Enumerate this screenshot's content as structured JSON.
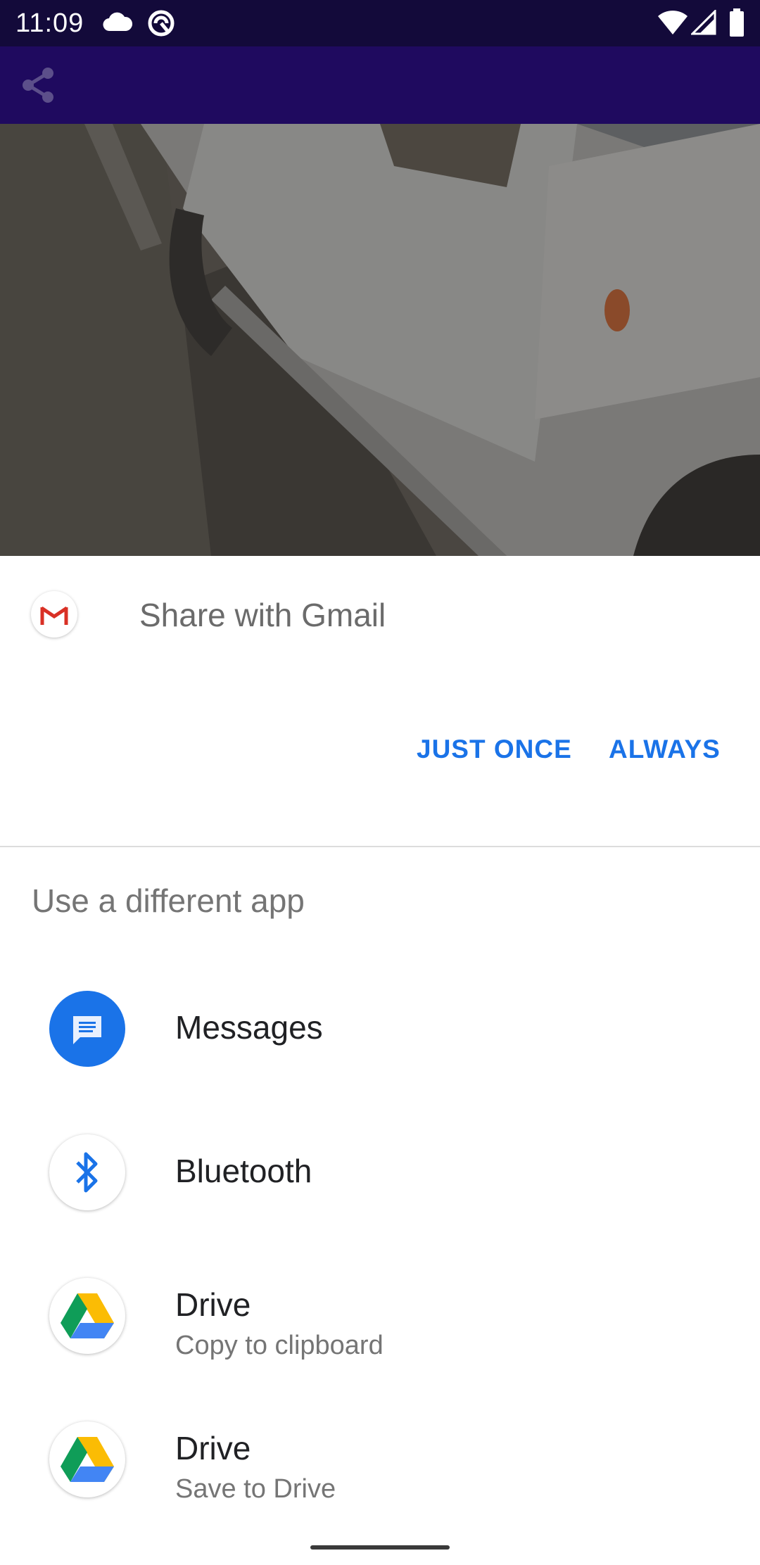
{
  "status_bar": {
    "time": "11:09",
    "icons": [
      "cloud-icon",
      "sync-icon",
      "wifi-icon",
      "cellular-signal-icon",
      "battery-icon"
    ]
  },
  "app_bar": {
    "icons": [
      "share-icon"
    ]
  },
  "share_sheet": {
    "default_app": {
      "icon": "gmail-icon",
      "title": "Share with Gmail"
    },
    "buttons": {
      "just_once": "JUST ONCE",
      "always": "ALWAYS"
    },
    "section_title": "Use a different app",
    "apps": [
      {
        "name": "Messages",
        "subtitle": "",
        "icon": "messages-icon"
      },
      {
        "name": "Bluetooth",
        "subtitle": "",
        "icon": "bluetooth-icon"
      },
      {
        "name": "Drive",
        "subtitle": "Copy to clipboard",
        "icon": "drive-icon"
      },
      {
        "name": "Drive",
        "subtitle": "Save to Drive",
        "icon": "drive-icon"
      }
    ]
  },
  "colors": {
    "status_bar_bg": "#130a3a",
    "app_bar_bg": "#1f0a5f",
    "accent_button": "#1a73e8"
  }
}
